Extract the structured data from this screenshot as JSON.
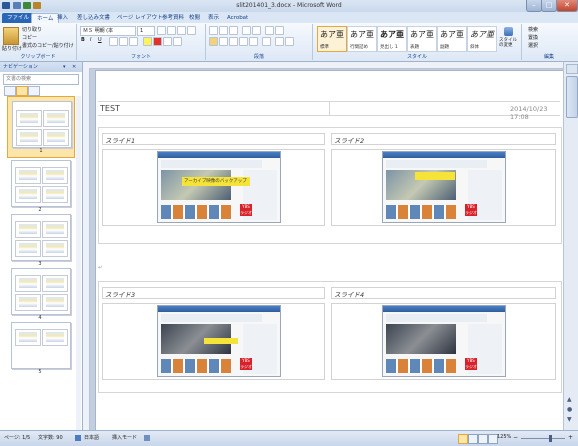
{
  "window": {
    "title": "slit201401_3.docx - Microsoft Word"
  },
  "ribbon": {
    "tabs": [
      {
        "label": "ファイル"
      },
      {
        "label": "ホーム"
      },
      {
        "label": "挿入"
      },
      {
        "label": "差し込み文書"
      },
      {
        "label": "ページ レイアウト"
      },
      {
        "label": "参考資料"
      },
      {
        "label": "校閲"
      },
      {
        "label": "表示"
      },
      {
        "label": "Acrobat"
      }
    ],
    "clipboard": {
      "paste": "貼り付け",
      "cut": "切り取り",
      "copy": "コピー",
      "format_painter": "書式のコピー/貼り付け",
      "label": "クリップボード"
    },
    "font": {
      "name": "ＭＳ 明朝 (本",
      "size": "1",
      "label": "フォント",
      "bold": "B",
      "italic": "I",
      "underline": "U"
    },
    "paragraph": {
      "label": "段落"
    },
    "styles": {
      "items": [
        {
          "big": "あア亜",
          "small": "標準"
        },
        {
          "big": "あア亜",
          "small": "行間詰め"
        },
        {
          "big": "あア亜",
          "small": "見出し 1"
        },
        {
          "big": "あア亜",
          "small": "表題"
        },
        {
          "big": "あア亜",
          "small": "副題"
        },
        {
          "big": "あア亜",
          "small": "斜体"
        }
      ],
      "change_styles": "スタイルの変更",
      "label": "スタイル"
    },
    "editing": {
      "find": "検索",
      "replace": "置換",
      "select": "選択",
      "label": "編集"
    }
  },
  "nav": {
    "header": "ナビゲーション",
    "search_placeholder": "文書の検索",
    "pages": [
      "1",
      "2",
      "3",
      "4",
      "5"
    ]
  },
  "document": {
    "header_left": "TEST",
    "header_right": "2014/10/23 17:08",
    "slides": [
      {
        "label": "スライド1",
        "caption": "アーカイブ映像のバックアップ"
      },
      {
        "label": "スライド2",
        "caption": ""
      },
      {
        "label": "スライド3",
        "caption": ""
      },
      {
        "label": "スライド4",
        "caption": ""
      }
    ],
    "red_tile_text": "YBS ラジオ"
  },
  "status": {
    "page": "ページ: 1/5",
    "words": "文字数: 90",
    "language": "日本語",
    "mode": "挿入モード",
    "zoom": "125%"
  },
  "colors": {
    "accent": "#2a66b7",
    "ribbon_bg": "#dde8f6",
    "doc_bg": "#c3cfe0"
  }
}
